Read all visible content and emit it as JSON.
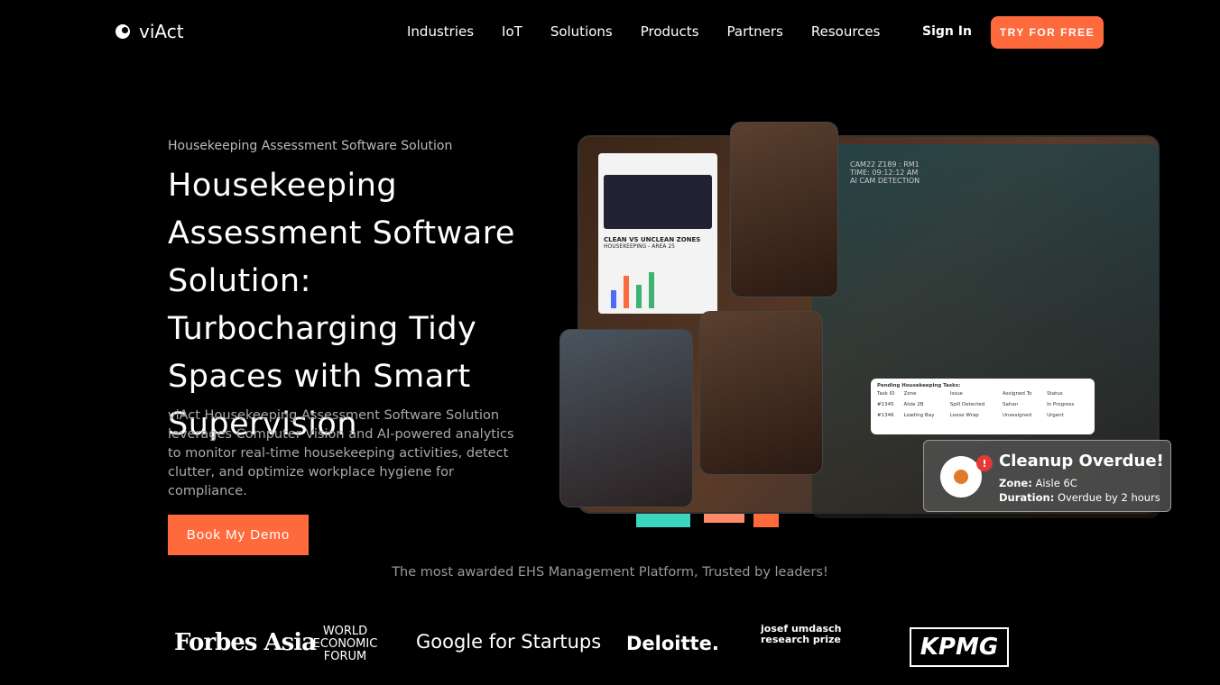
{
  "nav": {
    "brand": "viAct",
    "items": [
      "Industries",
      "IoT",
      "Solutions",
      "Products",
      "Partners",
      "Resources"
    ],
    "sign_in": "Sign In",
    "cta": "TRY FOR FREE"
  },
  "hero": {
    "eyebrow": "Housekeeping Assessment Software Solution",
    "title": "Housekeeping Assessment Software Solution: Turbocharging Tidy Spaces with Smart Supervision",
    "description": "viAct Housekeeping Assessment Software Solution leverages Computer Vision and AI-powered analytics to monitor real-time housekeeping activities, detect clutter, and optimize workplace hygiene for compliance.",
    "button": "Book My Demo"
  },
  "image": {
    "cam_text": [
      "CAM22 Z189 : RM1",
      "TIME: 09:12:12 AM",
      "AI CAM DETECTION"
    ],
    "dash_title": "CLEAN VS UNCLEAN ZONES",
    "dash_sub": "HOUSEKEEPING - AREA 25",
    "tasks": {
      "title": "Pending Housekeeping Tasks:",
      "headers": [
        "Task ID",
        "Zone",
        "Issue",
        "Assigned To",
        "Status"
      ],
      "rows": [
        [
          "#1345",
          "Aisle 2B",
          "Spill Detected",
          "Sahan",
          "In Progress"
        ],
        [
          "#1346",
          "Loading Bay",
          "Loose Wrap",
          "Unassigned",
          "Urgent"
        ]
      ]
    },
    "alert": {
      "title": "Cleanup Overdue!",
      "zone_label": "Zone:",
      "zone": "Aisle 6C",
      "duration_label": "Duration:",
      "duration": "Overdue by 2 hours"
    }
  },
  "trusted": "The most awarded EHS Management Platform, Trusted by leaders!",
  "logos": [
    "Forbes Asia",
    "WORLD ECONOMIC FORUM",
    "Google for Startups",
    "Deloitte.",
    "josef umdasch research prize",
    "KPMG"
  ]
}
